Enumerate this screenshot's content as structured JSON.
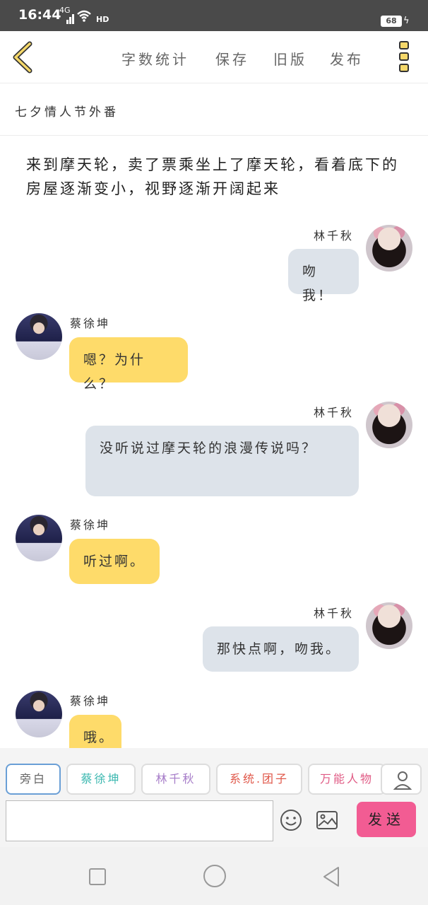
{
  "status": {
    "time": "16:44",
    "signal_label": "4G",
    "hd_label": "HD",
    "battery": "68"
  },
  "toolbar": {
    "word_count": "字数统计",
    "save": "保存",
    "old_version": "旧版",
    "publish": "发布"
  },
  "story_title": "七夕情人节外番",
  "chat": {
    "narration": "来到摩天轮，卖了票乘坐上了摩天轮，看着底下的房屋逐渐变小，视野逐渐开阔起来",
    "messages": [
      {
        "speaker": "林千秋",
        "side": "right",
        "text": "吻我！"
      },
      {
        "speaker": "蔡徐坤",
        "side": "left",
        "text": "嗯？为什么？"
      },
      {
        "speaker": "林千秋",
        "side": "right",
        "text": "没听说过摩天轮的浪漫传说吗？"
      },
      {
        "speaker": "蔡徐坤",
        "side": "left",
        "text": "听过啊。"
      },
      {
        "speaker": "林千秋",
        "side": "right",
        "text": "那快点啊，吻我。"
      },
      {
        "speaker": "蔡徐坤",
        "side": "left",
        "text": "哦。"
      }
    ]
  },
  "characters": [
    {
      "label": "旁白",
      "color": "#666666"
    },
    {
      "label": "蔡徐坤",
      "color": "#3cb8b0"
    },
    {
      "label": "林千秋",
      "color": "#a67cc8"
    },
    {
      "label": "系统.团子",
      "color": "#e0584a"
    },
    {
      "label": "万能人物",
      "color": "#e05a84"
    }
  ],
  "input": {
    "placeholder": "",
    "send_label": "发送"
  },
  "colors": {
    "accent_left_bubble": "#fedb6a",
    "right_bubble": "#dde3ea",
    "send_button": "#f25c93"
  }
}
